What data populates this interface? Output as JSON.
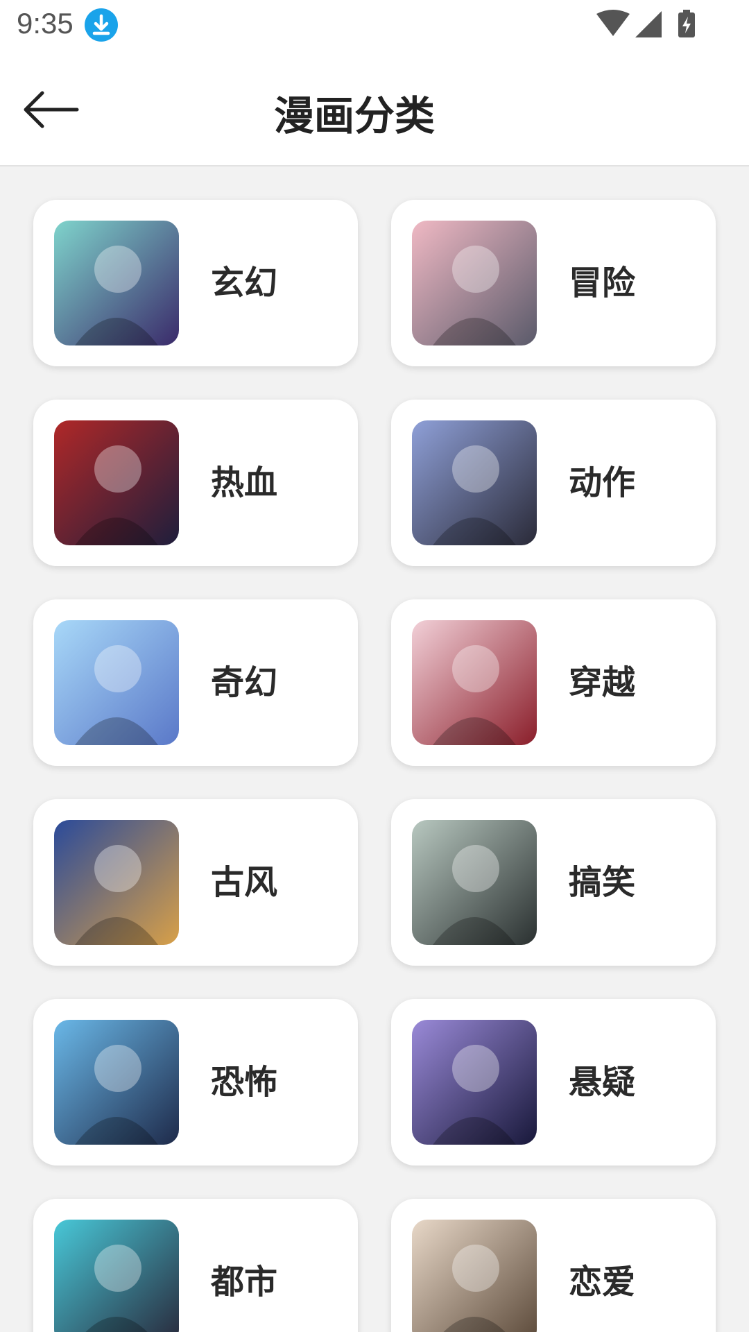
{
  "status_bar": {
    "time": "9:35",
    "icons": [
      "download-icon",
      "wifi-icon",
      "cell-signal-icon",
      "battery-charging-icon"
    ]
  },
  "header": {
    "back_icon": "arrow-left-icon",
    "title": "漫画分类"
  },
  "colors": {
    "background": "#f2f2f2",
    "card": "#ffffff",
    "accent_download": "#1aa3ea",
    "text": "#2a2a2a"
  },
  "categories": [
    {
      "label": "玄幻",
      "thumb_color_a": "#7fd4cc",
      "thumb_color_b": "#3a2a6a"
    },
    {
      "label": "冒险",
      "thumb_color_a": "#f0b9c4",
      "thumb_color_b": "#5a5a6a"
    },
    {
      "label": "热血",
      "thumb_color_a": "#b02828",
      "thumb_color_b": "#1e1e3c"
    },
    {
      "label": "动作",
      "thumb_color_a": "#8fa0d8",
      "thumb_color_b": "#2a2a38"
    },
    {
      "label": "奇幻",
      "thumb_color_a": "#a8d8f8",
      "thumb_color_b": "#5a78c8"
    },
    {
      "label": "穿越",
      "thumb_color_a": "#f2d0d8",
      "thumb_color_b": "#8a1e2a"
    },
    {
      "label": "古风",
      "thumb_color_a": "#2a4a9a",
      "thumb_color_b": "#d8a048"
    },
    {
      "label": "搞笑",
      "thumb_color_a": "#b8c8c0",
      "thumb_color_b": "#2a3030"
    },
    {
      "label": "恐怖",
      "thumb_color_a": "#6ab8e8",
      "thumb_color_b": "#1e2a4a"
    },
    {
      "label": "悬疑",
      "thumb_color_a": "#9a8ad8",
      "thumb_color_b": "#18183a"
    },
    {
      "label": "都市",
      "thumb_color_a": "#48c8d8",
      "thumb_color_b": "#28283a"
    },
    {
      "label": "恋爱",
      "thumb_color_a": "#e8d8c8",
      "thumb_color_b": "#5a4838"
    }
  ]
}
